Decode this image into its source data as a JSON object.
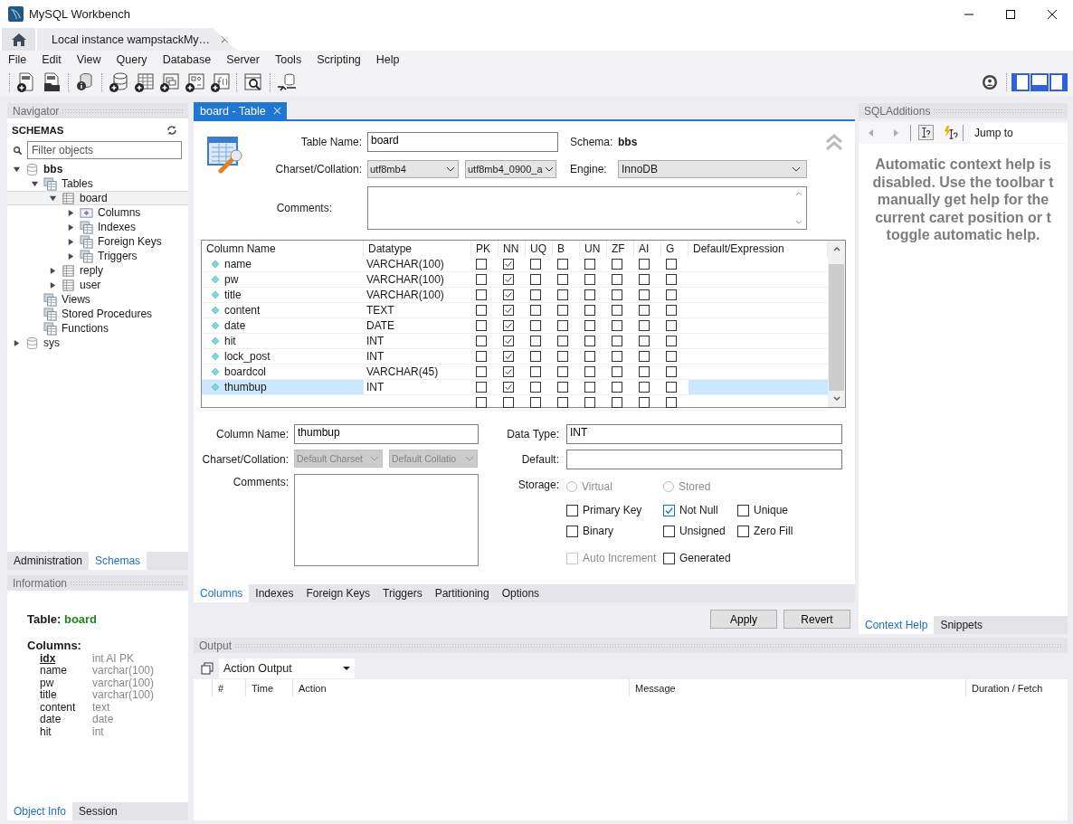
{
  "window": {
    "title": "MySQL Workbench"
  },
  "connection_tab": {
    "label": "Local instance wampstackMy…"
  },
  "menu": [
    "File",
    "Edit",
    "View",
    "Query",
    "Database",
    "Server",
    "Tools",
    "Scripting",
    "Help"
  ],
  "layout_toggles": [
    {
      "on": true
    },
    {
      "on": true
    },
    {
      "on": true
    }
  ],
  "navigator": {
    "title": "Navigator",
    "schemas_heading": "SCHEMAS",
    "filter": {
      "placeholder": "Filter objects"
    },
    "tree": [
      {
        "label": "bbs",
        "kind": "schema",
        "default_schema": true,
        "expanded": true,
        "selected": false,
        "children": [
          {
            "label": "Tables",
            "kind": "group",
            "expanded": true,
            "selected": false,
            "children": [
              {
                "label": "board",
                "kind": "table",
                "expanded": true,
                "selected": true,
                "children": [
                  {
                    "label": "Columns",
                    "kind": "columns",
                    "expanded": false,
                    "selected": false
                  },
                  {
                    "label": "Indexes",
                    "kind": "group",
                    "expanded": false,
                    "selected": false
                  },
                  {
                    "label": "Foreign Keys",
                    "kind": "group",
                    "expanded": false,
                    "selected": false
                  },
                  {
                    "label": "Triggers",
                    "kind": "group",
                    "expanded": false,
                    "selected": false
                  }
                ]
              },
              {
                "label": "reply",
                "kind": "table",
                "expanded": false,
                "selected": false
              },
              {
                "label": "user",
                "kind": "table",
                "expanded": false,
                "selected": false
              }
            ]
          },
          {
            "label": "Views",
            "kind": "group",
            "selected": false
          },
          {
            "label": "Stored Procedures",
            "kind": "group",
            "selected": false
          },
          {
            "label": "Functions",
            "kind": "group",
            "selected": false
          }
        ]
      },
      {
        "label": "sys",
        "kind": "schema",
        "default_schema": false,
        "expanded": false,
        "selected": false
      }
    ],
    "tabs": [
      {
        "label": "Administration",
        "selected": false
      },
      {
        "label": "Schemas",
        "selected": true
      }
    ]
  },
  "information": {
    "title": "Information",
    "table_label": "Table:",
    "table_name": "board",
    "columns_label": "Columns:",
    "columns": [
      {
        "name": "idx",
        "type": "int AI PK",
        "primary": true
      },
      {
        "name": "name",
        "type": "varchar(100)",
        "primary": false
      },
      {
        "name": "pw",
        "type": "varchar(100)",
        "primary": false
      },
      {
        "name": "title",
        "type": "varchar(100)",
        "primary": false
      },
      {
        "name": "content",
        "type": "text",
        "primary": false
      },
      {
        "name": "date",
        "type": "date",
        "primary": false
      },
      {
        "name": "hit",
        "type": "int",
        "primary": false
      }
    ],
    "tabs": [
      {
        "label": "Object Info",
        "selected": true
      },
      {
        "label": "Session",
        "selected": false
      }
    ]
  },
  "editor": {
    "tab": {
      "label": "board - Table"
    },
    "table_name_label": "Table Name:",
    "table_name": "board",
    "schema_label": "Schema:",
    "schema": "bbs",
    "charset_label": "Charset/Collation:",
    "charset": "utf8mb4",
    "collation": "utf8mb4_0900_a",
    "engine_label": "Engine:",
    "engine": "InnoDB",
    "comments_label": "Comments:",
    "grid": {
      "columns": [
        "Column Name",
        "Datatype",
        "PK",
        "NN",
        "UQ",
        "B",
        "UN",
        "ZF",
        "AI",
        "G",
        "Default/Expression"
      ],
      "rows": [
        {
          "name": "name",
          "datatype": "VARCHAR(100)",
          "selected": false,
          "flags": [
            false,
            true,
            false,
            false,
            false,
            false,
            false,
            false
          ]
        },
        {
          "name": "pw",
          "datatype": "VARCHAR(100)",
          "selected": false,
          "flags": [
            false,
            true,
            false,
            false,
            false,
            false,
            false,
            false
          ]
        },
        {
          "name": "title",
          "datatype": "VARCHAR(100)",
          "selected": false,
          "flags": [
            false,
            true,
            false,
            false,
            false,
            false,
            false,
            false
          ]
        },
        {
          "name": "content",
          "datatype": "TEXT",
          "selected": false,
          "flags": [
            false,
            true,
            false,
            false,
            false,
            false,
            false,
            false
          ]
        },
        {
          "name": "date",
          "datatype": "DATE",
          "selected": false,
          "flags": [
            false,
            true,
            false,
            false,
            false,
            false,
            false,
            false
          ]
        },
        {
          "name": "hit",
          "datatype": "INT",
          "selected": false,
          "flags": [
            false,
            true,
            false,
            false,
            false,
            false,
            false,
            false
          ]
        },
        {
          "name": "lock_post",
          "datatype": "INT",
          "selected": false,
          "flags": [
            false,
            true,
            false,
            false,
            false,
            false,
            false,
            false
          ]
        },
        {
          "name": "boardcol",
          "datatype": "VARCHAR(45)",
          "selected": false,
          "flags": [
            false,
            true,
            false,
            false,
            false,
            false,
            false,
            false
          ]
        },
        {
          "name": "thumbup",
          "datatype": "INT",
          "selected": true,
          "flags": [
            false,
            true,
            false,
            false,
            false,
            false,
            false,
            false
          ]
        },
        {
          "selected": false,
          "flags": [
            false,
            false,
            false,
            false,
            false,
            false,
            false,
            false
          ]
        }
      ]
    },
    "details": {
      "column_name_label": "Column Name:",
      "column_name": "thumbup",
      "data_type_label": "Data Type:",
      "data_type": "INT",
      "charset_label": "Charset/Collation:",
      "charset": "Default Charset",
      "collation": "Default Collatio",
      "charset_disabled": true,
      "default_label": "Default:",
      "comments_label": "Comments:",
      "storage_label": "Storage:",
      "storage": [
        {
          "label": "Virtual",
          "selected": false,
          "disabled": true
        },
        {
          "label": "Stored",
          "selected": false,
          "disabled": true
        }
      ],
      "flags": [
        {
          "label": "Primary Key",
          "checked": false,
          "disabled": false
        },
        {
          "label": "Not Null",
          "checked": true,
          "disabled": false
        },
        {
          "label": "Unique",
          "checked": false,
          "disabled": false
        },
        {
          "label": "Binary",
          "checked": false,
          "disabled": false
        },
        {
          "label": "Unsigned",
          "checked": false,
          "disabled": false
        },
        {
          "label": "Zero Fill",
          "checked": false,
          "disabled": false
        },
        {
          "label": "Auto Increment",
          "checked": false,
          "disabled": true
        },
        {
          "label": "Generated",
          "checked": false,
          "disabled": false
        }
      ]
    },
    "subtabs": [
      {
        "label": "Columns",
        "selected": true
      },
      {
        "label": "Indexes",
        "selected": false
      },
      {
        "label": "Foreign Keys",
        "selected": false
      },
      {
        "label": "Triggers",
        "selected": false
      },
      {
        "label": "Partitioning",
        "selected": false
      },
      {
        "label": "Options",
        "selected": false
      }
    ],
    "buttons": [
      "Apply",
      "Revert"
    ]
  },
  "output": {
    "title": "Output",
    "selector": "Action Output",
    "columns": [
      "#",
      "Time",
      "Action",
      "Message",
      "Duration / Fetch"
    ]
  },
  "sql_additions": {
    "title": "SQLAdditions",
    "jump_to": "Jump to",
    "help_lines": [
      "Automatic context help is",
      "disabled. Use the toolbar t",
      "manually get help for the",
      "current caret position or t",
      "toggle automatic help."
    ],
    "tabs": [
      {
        "label": "Context Help",
        "selected": true
      },
      {
        "label": "Snippets",
        "selected": false
      }
    ]
  }
}
